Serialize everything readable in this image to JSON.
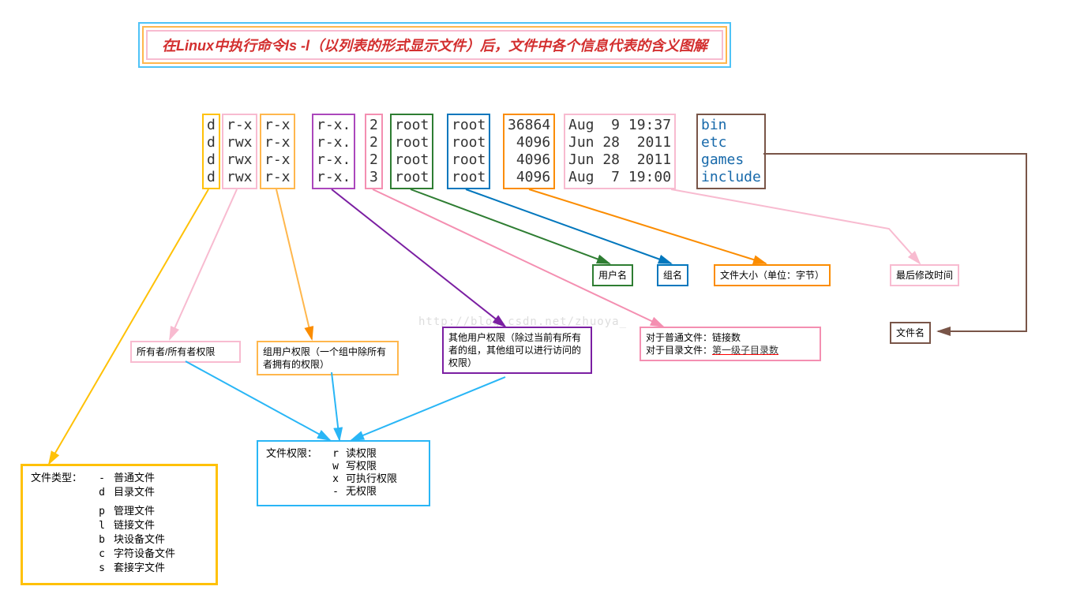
{
  "title": "在Linux中执行命令ls -l（以列表的形式显示文件）后，文件中各个信息代表的含义图解",
  "watermark": "http://blog.csdn.net/zhuoya_",
  "cols": {
    "type": "d\nd\nd\nd",
    "perm1": "r-x\nrwx\nrwx\nrwx",
    "perm2": "r-x\nr-x\nr-x\nr-x",
    "perm3": "r-x.\nr-x.\nr-x.\nr-x.",
    "links": "2\n2\n2\n3",
    "user": "root\nroot\nroot\nroot",
    "group": "root\nroot\nroot\nroot",
    "size": "36864\n 4096\n 4096\n 4096",
    "date": "Aug  9 19:37\nJun 28  2011\nJun 28  2011\nAug  7 19:00",
    "name": "bin\netc\ngames\ninclude"
  },
  "labels": {
    "user": "用户名",
    "group": "组名",
    "size": "文件大小（单位：字节）",
    "mtime": "最后修改时间",
    "filename": "文件名",
    "owner_perm": "所有者/所有者权限",
    "group_perm": "组用户权限（一个组中除所有者拥有的权限）",
    "other_perm": "其他用户权限（除过当前有所有者的组，其他组可以进行访问的权限）",
    "links_normal": "对于普通文件：链接数",
    "links_dir": "对于目录文件：",
    "links_dir2": "第一级子目录数"
  },
  "filetype_box": {
    "title": "文件类型：",
    "items": [
      [
        "-",
        "普通文件"
      ],
      [
        "d",
        "目录文件"
      ],
      [
        "p",
        "管理文件"
      ],
      [
        "l",
        "链接文件"
      ],
      [
        "b",
        "块设备文件"
      ],
      [
        "c",
        "字符设备文件"
      ],
      [
        "s",
        "套接字文件"
      ]
    ]
  },
  "perm_box": {
    "title": "文件权限：",
    "items": [
      [
        "r",
        "读权限"
      ],
      [
        "w",
        "写权限"
      ],
      [
        "x",
        "可执行权限"
      ],
      [
        "-",
        "无权限"
      ]
    ]
  },
  "colors": {
    "type": "#ffc107",
    "perm1": "#f8bbd0",
    "perm2": "#ffb74d",
    "perm3": "#ab47bc",
    "links": "#f48fb1",
    "user": "#2e7d32",
    "group": "#0277bd",
    "size": "#fb8c00",
    "date": "#f8bbd0",
    "name": "#795548",
    "blue": "#1e88e5",
    "perms_box": "#29b6f6"
  }
}
